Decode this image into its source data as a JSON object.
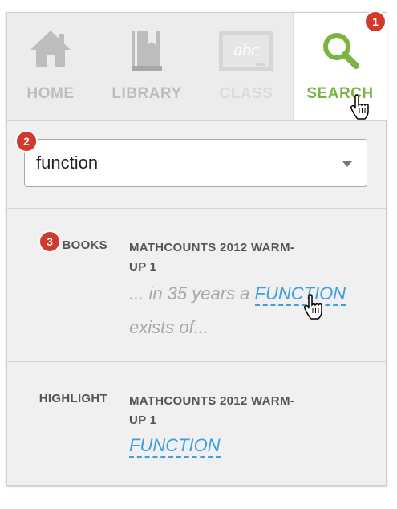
{
  "nav": {
    "items": [
      {
        "id": "home",
        "label": "HOME",
        "icon": "home-icon",
        "state": "inactive"
      },
      {
        "id": "library",
        "label": "LIBRARY",
        "icon": "book-icon",
        "state": "inactive"
      },
      {
        "id": "class",
        "label": "CLASS",
        "icon": "chalkboard-icon",
        "state": "disabled",
        "icon_text": "abc"
      },
      {
        "id": "search",
        "label": "SEARCH",
        "icon": "search-icon",
        "state": "active"
      }
    ]
  },
  "badges": [
    "1",
    "2",
    "3"
  ],
  "search": {
    "value": "function"
  },
  "results": [
    {
      "type": "BOOKS",
      "title": "MATHCOUNTS 2012 WARM-UP 1",
      "snippet_before": "... in 35 years a ",
      "highlight": "FUNCTION",
      "snippet_after": "exists of..."
    },
    {
      "type": "HIGHLIGHT",
      "title": "MATHCOUNTS 2012 WARM-UP 1",
      "snippet_before": "",
      "highlight": "FUNCTION",
      "snippet_after": ""
    }
  ],
  "colors": {
    "accent_green": "#7cb342",
    "link_blue": "#3aa0df",
    "badge_red": "#d0392b",
    "inactive_gray": "#bdbdbd"
  }
}
